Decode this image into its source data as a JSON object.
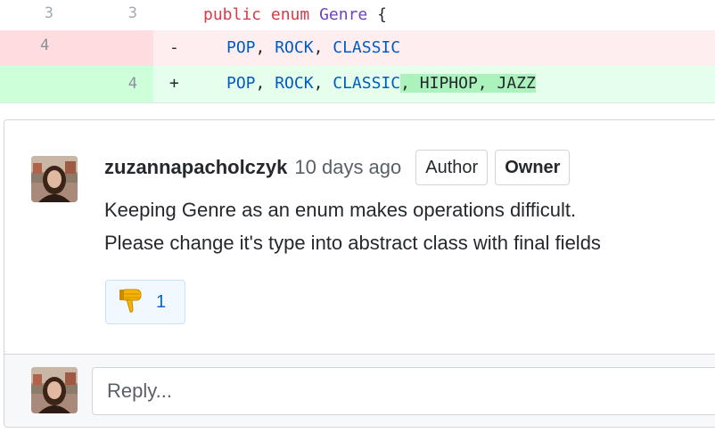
{
  "diff": {
    "context_line": {
      "old_num": "3",
      "new_num": "3",
      "keyword1": "public",
      "keyword2": "enum",
      "type_name": "Genre",
      "brace": "{"
    },
    "deleted_line": {
      "old_num": "4",
      "marker": "-",
      "c1": "POP",
      "c2": "ROCK",
      "c3": "CLASSIC"
    },
    "added_line": {
      "new_num": "4",
      "marker": "+",
      "c1": "POP",
      "c2": "ROCK",
      "c3": "CLASSIC",
      "added_text": ", HIPHOP, JAZZ"
    },
    "colors": {
      "deleted_bg": "#ffeef0",
      "added_bg": "#e6ffed",
      "added_highlight": "#acf2bd"
    }
  },
  "comment": {
    "author": "zuzannapacholczyk",
    "time": "10 days ago",
    "badges": [
      "Author",
      "Owner"
    ],
    "body_line1": "Keeping Genre as an enum makes operations difficult.",
    "body_line2": "Please change it's type into abstract class with final fields",
    "reaction": {
      "icon": "thumbs-down-icon",
      "count": "1"
    }
  },
  "reply": {
    "placeholder": "Reply..."
  }
}
